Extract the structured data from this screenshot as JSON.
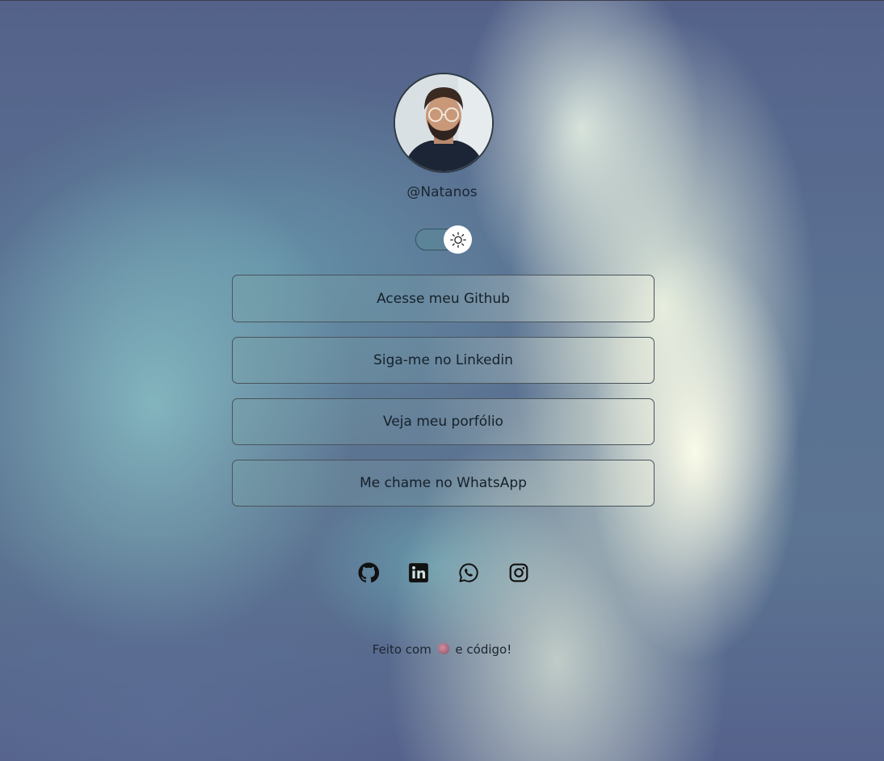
{
  "profile": {
    "username": "@Natanos",
    "avatar_alt": "profile photo"
  },
  "theme_toggle": {
    "icon": "sun-icon",
    "state": "light"
  },
  "links": [
    {
      "label": "Acesse meu Github"
    },
    {
      "label": "Siga-me no Linkedin"
    },
    {
      "label": "Veja meu porfólio"
    },
    {
      "label": "Me chame no WhatsApp"
    }
  ],
  "socials": [
    {
      "icon": "github-icon"
    },
    {
      "icon": "linkedin-icon"
    },
    {
      "icon": "whatsapp-icon"
    },
    {
      "icon": "instagram-icon"
    }
  ],
  "footer": {
    "before": "Feito com",
    "after": "e código!",
    "emoji": "heart-icon"
  },
  "colors": {
    "text": "#16222a",
    "toggle_track": "#5a8796",
    "knob": "#ffffff"
  }
}
